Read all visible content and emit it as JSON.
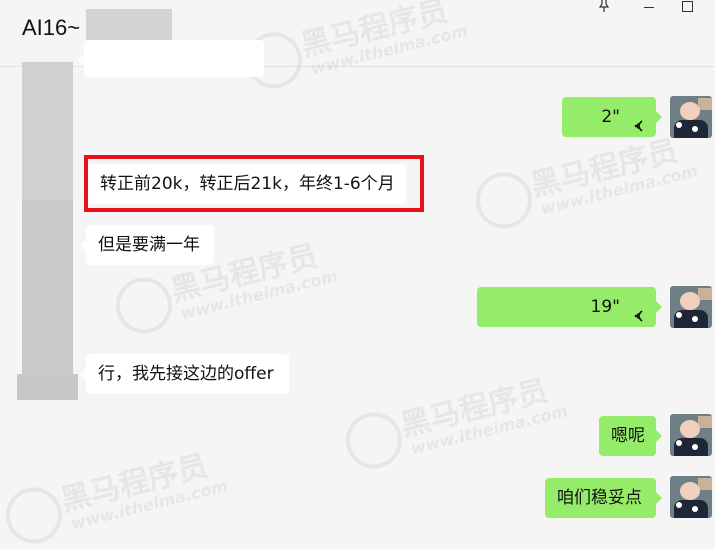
{
  "window": {
    "title": "AI16~",
    "pin_icon": "pin-icon",
    "minimize_icon": "minimize-icon",
    "maximize_icon": "maximize-icon"
  },
  "watermark": {
    "brand": "黑马程序员",
    "url": "www.itheima.com"
  },
  "messages": [
    {
      "side": "right",
      "type": "voice",
      "duration": "2\""
    },
    {
      "side": "left",
      "type": "text",
      "text": "转正前20k，转正后21k，年终1-6个月",
      "highlighted": true
    },
    {
      "side": "left",
      "type": "text",
      "text": "但是要满一年"
    },
    {
      "side": "right",
      "type": "voice",
      "duration": "19\""
    },
    {
      "side": "left",
      "type": "text",
      "text": "行，我先接这边的offer"
    },
    {
      "side": "right",
      "type": "text",
      "text": "嗯呢"
    },
    {
      "side": "right",
      "type": "text",
      "text": "咱们稳妥点"
    }
  ],
  "colors": {
    "background": "#f5f5f5",
    "sent_bubble": "#95ec69",
    "received_bubble": "#ffffff",
    "highlight_border": "#e8101a"
  }
}
